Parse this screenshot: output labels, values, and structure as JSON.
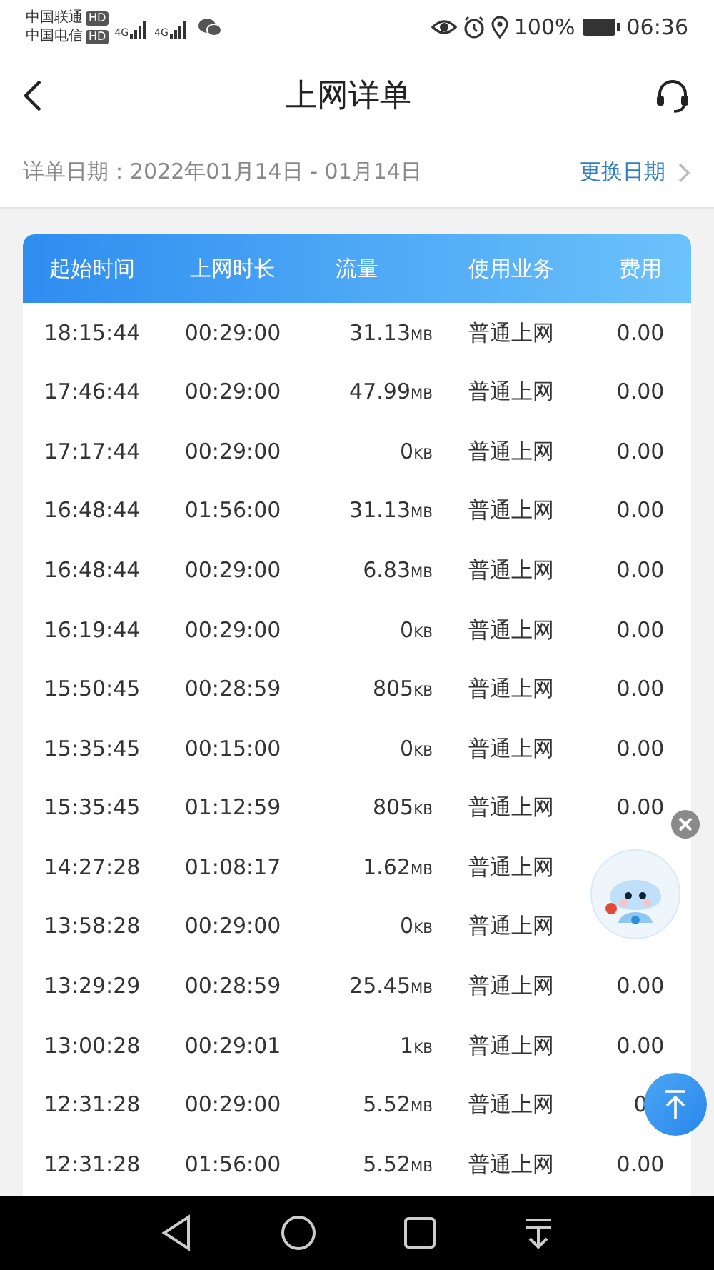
{
  "status_bar": {
    "carriers": [
      {
        "name": "中国联通",
        "badge": "HD"
      },
      {
        "name": "中国电信",
        "badge": "HD"
      }
    ],
    "networks": [
      "4G",
      "4G"
    ],
    "battery": "100%",
    "time": "06:36"
  },
  "header": {
    "title": "上网详单"
  },
  "date_bar": {
    "label": "详单日期：2022年01月14日 - 01月14日",
    "action": "更换日期"
  },
  "table": {
    "columns": [
      "起始时间",
      "上网时长",
      "流量",
      "使用业务",
      "费用"
    ],
    "rows": [
      {
        "start": "18:15:44",
        "duration": "00:29:00",
        "amount": "31.13",
        "unit": "MB",
        "service": "普通上网",
        "cost": "0.00"
      },
      {
        "start": "17:46:44",
        "duration": "00:29:00",
        "amount": "47.99",
        "unit": "MB",
        "service": "普通上网",
        "cost": "0.00"
      },
      {
        "start": "17:17:44",
        "duration": "00:29:00",
        "amount": "0",
        "unit": "KB",
        "service": "普通上网",
        "cost": "0.00"
      },
      {
        "start": "16:48:44",
        "duration": "01:56:00",
        "amount": "31.13",
        "unit": "MB",
        "service": "普通上网",
        "cost": "0.00"
      },
      {
        "start": "16:48:44",
        "duration": "00:29:00",
        "amount": "6.83",
        "unit": "MB",
        "service": "普通上网",
        "cost": "0.00"
      },
      {
        "start": "16:19:44",
        "duration": "00:29:00",
        "amount": "0",
        "unit": "KB",
        "service": "普通上网",
        "cost": "0.00"
      },
      {
        "start": "15:50:45",
        "duration": "00:28:59",
        "amount": "805",
        "unit": "KB",
        "service": "普通上网",
        "cost": "0.00"
      },
      {
        "start": "15:35:45",
        "duration": "00:15:00",
        "amount": "0",
        "unit": "KB",
        "service": "普通上网",
        "cost": "0.00"
      },
      {
        "start": "15:35:45",
        "duration": "01:12:59",
        "amount": "805",
        "unit": "KB",
        "service": "普通上网",
        "cost": "0.00"
      },
      {
        "start": "14:27:28",
        "duration": "01:08:17",
        "amount": "1.62",
        "unit": "MB",
        "service": "普通上网"
      },
      {
        "start": "13:58:28",
        "duration": "00:29:00",
        "amount": "0",
        "unit": "KB",
        "service": "普通上网"
      },
      {
        "start": "13:29:29",
        "duration": "00:28:59",
        "amount": "25.45",
        "unit": "MB",
        "service": "普通上网",
        "cost": "0.00"
      },
      {
        "start": "13:00:28",
        "duration": "00:29:01",
        "amount": "1",
        "unit": "KB",
        "service": "普通上网",
        "cost": "0.00"
      },
      {
        "start": "12:31:28",
        "duration": "00:29:00",
        "amount": "5.52",
        "unit": "MB",
        "service": "普通上网",
        "cost": "0"
      },
      {
        "start": "12:31:28",
        "duration": "01:56:00",
        "amount": "5.52",
        "unit": "MB",
        "service": "普通上网",
        "cost": "0.00"
      }
    ]
  }
}
